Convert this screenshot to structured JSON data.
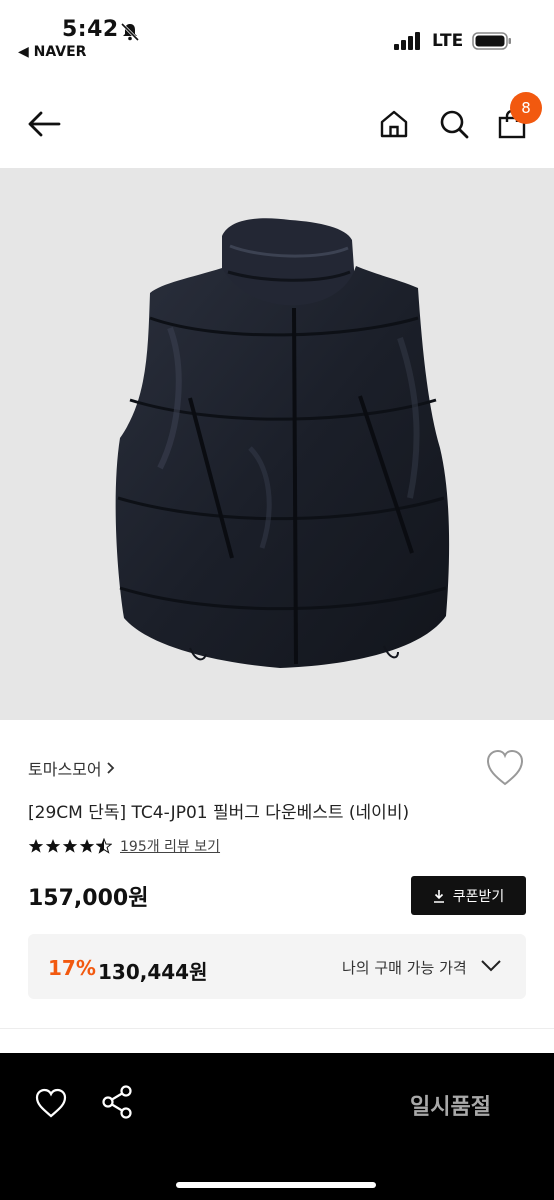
{
  "status": {
    "time": "5:42",
    "back_app": "◀ NAVER",
    "network": "LTE"
  },
  "nav": {
    "cart_count": "8"
  },
  "product": {
    "brand": "토마스모어",
    "title": "[29CM 단독] TC4-JP01 필버그 다운베스트 (네이비)",
    "rating": 4.5,
    "review_text": "195개 리뷰 보기",
    "price": "157,000원",
    "coupon_label": "쿠폰받기",
    "discount_rate": "17%",
    "discount_price": "130,444원",
    "discount_label": "나의 구매 가능 가격"
  },
  "bottom": {
    "soldout_label": "일시품절"
  },
  "colors": {
    "accent": "#f2590f",
    "dark": "#111111"
  }
}
